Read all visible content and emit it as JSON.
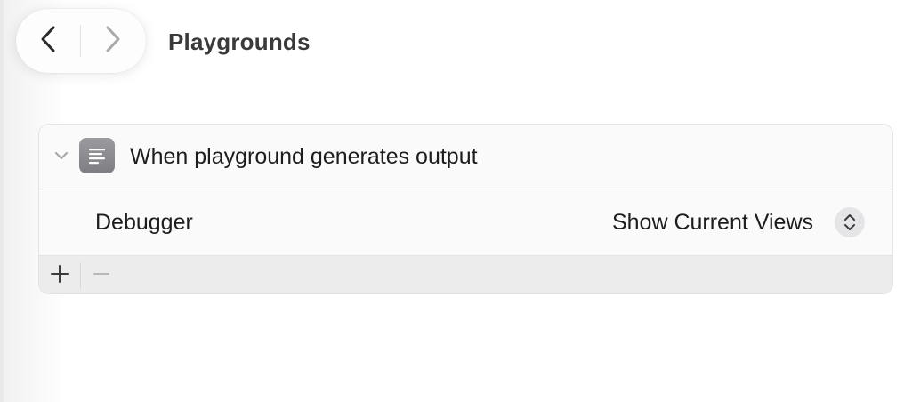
{
  "window": {
    "title": "Playgrounds"
  },
  "navigation": {
    "back_icon": "chevron-left-icon",
    "forward_icon": "chevron-right-icon",
    "forward_enabled": false
  },
  "behavior_group": {
    "header": {
      "title": "When playground generates output",
      "icon": "text-lines-icon",
      "expanded": true
    },
    "rows": [
      {
        "label": "Debugger",
        "value": "Show Current Views",
        "control_icon": "up-down-chevrons-icon"
      }
    ],
    "footer": {
      "add_icon": "plus-icon",
      "remove_icon": "minus-icon",
      "remove_enabled": false
    }
  },
  "colors": {
    "accent_icon_bg": "#8c8c91",
    "card_bg": "#fafafa",
    "footer_bg": "#ececec"
  }
}
